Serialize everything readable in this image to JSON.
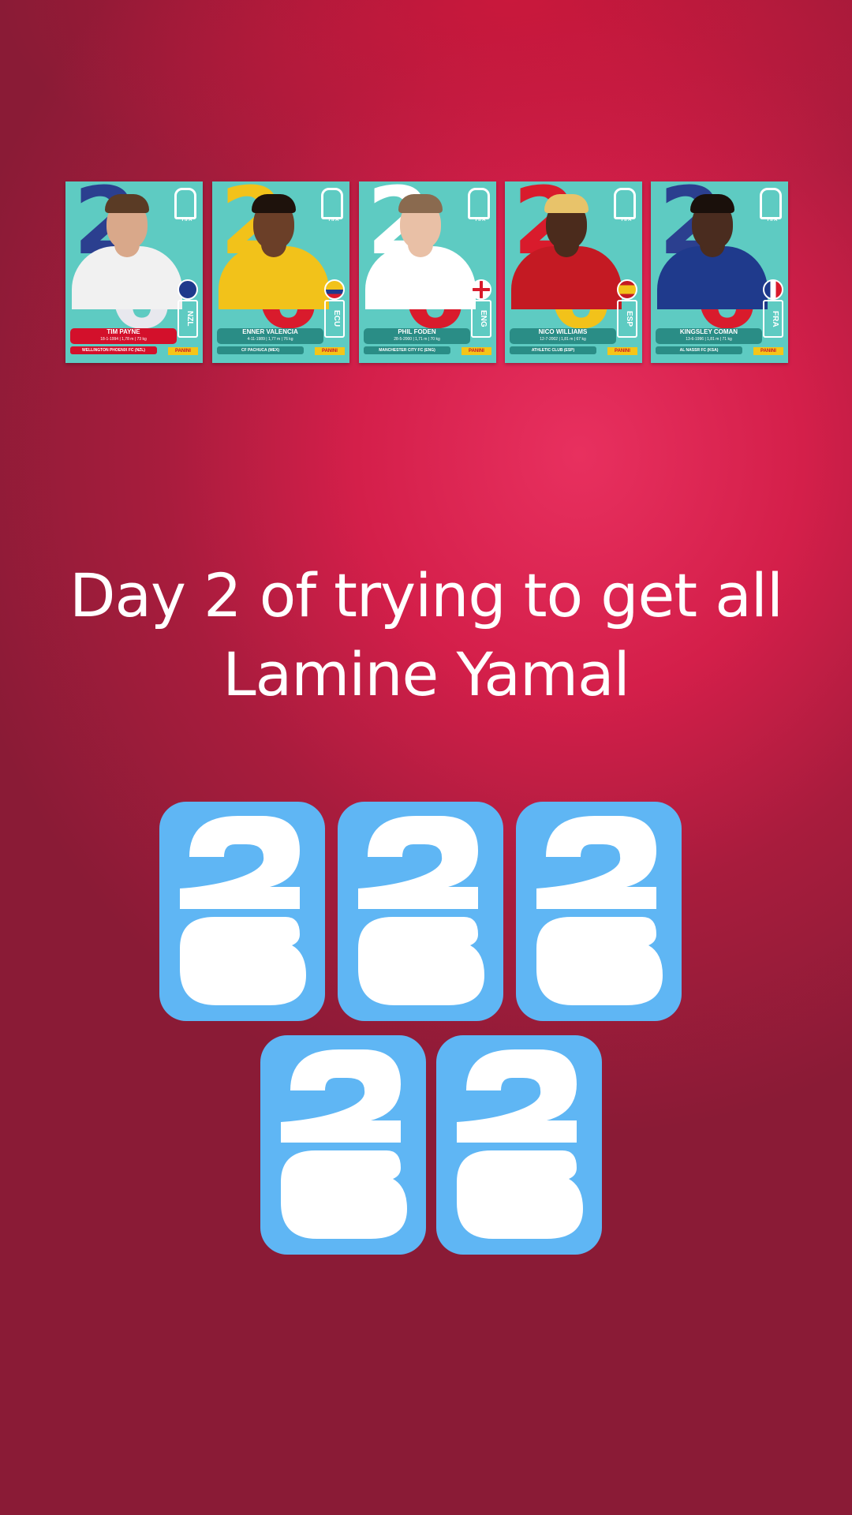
{
  "caption": {
    "line1": "Day 2 of trying to get all",
    "line2": "Lamine Yamal"
  },
  "stickers": [
    {
      "first": "TIM",
      "last": "PAYNE",
      "bio": "18-1-1994 | 1,78 m | 73 kg",
      "club": "WELLINGTON PHOENIX FC (NZL)",
      "code": "NZL",
      "shirt_color": "#f1f1f1",
      "skin": "#d9a88a",
      "hair": "#5a3b25",
      "plate_color": "#d3102b",
      "num_color_1": "#2b3f8f",
      "num_color_2": "#e8e8ee",
      "flag": "new-zealand-flag-icon"
    },
    {
      "first": "ENNER",
      "last": "VALENCIA",
      "bio": "4-11-1989 | 1,77 m | 76 kg",
      "club": "CF PACHUCA (MEX)",
      "code": "ECU",
      "shirt_color": "#f2c21a",
      "skin": "#6b3f28",
      "hair": "#1e120c",
      "plate_color": "#2a8d86",
      "num_color_1": "#f2c21a",
      "num_color_2": "#d91b2c",
      "flag": "ecuador-flag-icon"
    },
    {
      "first": "PHIL",
      "last": "FODEN",
      "bio": "28-5-2000 | 1,71 m | 70 kg",
      "club": "MANCHESTER CITY FC (ENG)",
      "code": "ENG",
      "shirt_color": "#ffffff",
      "skin": "#e9c0a6",
      "hair": "#8a6a4f",
      "plate_color": "#2a8d86",
      "num_color_1": "#ffffff",
      "num_color_2": "#d91b2c",
      "flag": "england-flag-icon"
    },
    {
      "first": "NICO",
      "last": "WILLIAMS",
      "bio": "12-7-2002 | 1,81 m | 67 kg",
      "club": "ATHLETIC CLUB (ESP)",
      "code": "ESP",
      "shirt_color": "#c41a23",
      "skin": "#4b2b1c",
      "hair": "#e8c36a",
      "plate_color": "#2a8d86",
      "num_color_1": "#d91b2c",
      "num_color_2": "#f2c21a",
      "flag": "spain-flag-icon"
    },
    {
      "first": "KINGSLEY",
      "last": "COMAN",
      "bio": "13-6-1996 | 1,81 m | 71 kg",
      "club": "AL NASSR FC (KSA)",
      "code": "FRA",
      "shirt_color": "#1f3a8c",
      "skin": "#4a2c1f",
      "hair": "#1a100b",
      "plate_color": "#2a8d86",
      "num_color_1": "#2b3f8f",
      "num_color_2": "#d91b2c",
      "flag": "france-flag-icon"
    }
  ],
  "sticker_badge": "PANINI",
  "cup_label": "FIFA",
  "packs": [
    {
      "label": "pack-1"
    },
    {
      "label": "pack-2"
    },
    {
      "label": "pack-3"
    },
    {
      "label": "pack-4"
    },
    {
      "label": "pack-5"
    }
  ],
  "colors": {
    "pack_blue": "#5fb6f4",
    "sticker_teal": "#5ecbc2",
    "text": "#ffffff"
  }
}
